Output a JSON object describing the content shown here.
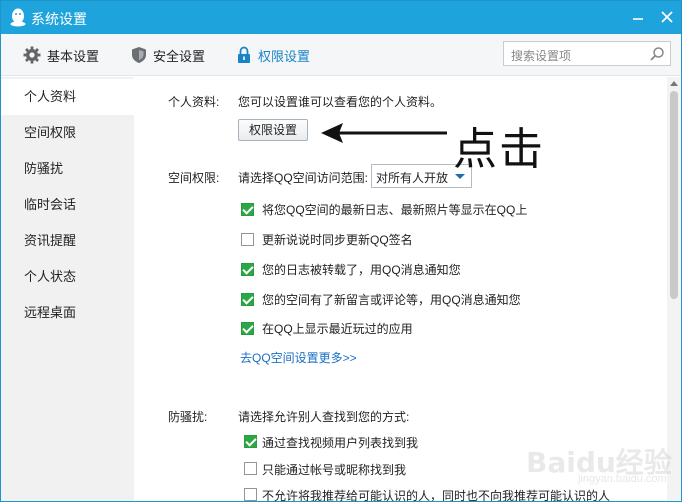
{
  "window": {
    "title": "系统设置"
  },
  "toolbar": {
    "basic_label": "基本设置",
    "security_label": "安全设置",
    "permission_label": "权限设置",
    "search_placeholder": "搜索设置项",
    "active_color": "#1a83c8"
  },
  "sidebar": {
    "items": [
      {
        "label": "个人资料",
        "active": true
      },
      {
        "label": "空间权限"
      },
      {
        "label": "防骚扰"
      },
      {
        "label": "临时会话"
      },
      {
        "label": "资讯提醒"
      },
      {
        "label": "个人状态"
      },
      {
        "label": "远程桌面"
      }
    ]
  },
  "profile": {
    "label": "个人资料:",
    "description": "您可以设置谁可以查看您的个人资料。",
    "button_label": "权限设置"
  },
  "annotation": {
    "text": "点击"
  },
  "space": {
    "label": "空间权限:",
    "range_label": "请选择QQ空间访问范围:",
    "range_value": "对所有人开放",
    "options": [
      {
        "label": "将您QQ空间的最新日志、最新照片等显示在QQ上",
        "checked": true
      },
      {
        "label": "更新说说时同步更新QQ签名",
        "checked": false
      },
      {
        "label": "您的日志被转载了，用QQ消息通知您",
        "checked": true
      },
      {
        "label": "您的空间有了新留言或评论等，用QQ消息通知您",
        "checked": true
      },
      {
        "label": "在QQ上显示最近玩过的应用",
        "checked": true
      }
    ],
    "more_link": "去QQ空间设置更多>>"
  },
  "harass": {
    "label": "防骚扰:",
    "description": "请选择允许别人查找到您的方式:",
    "options": [
      {
        "label": "通过查找视频用户列表找到我",
        "checked": true
      },
      {
        "label": "只能通过帐号或昵称找到我",
        "checked": false
      },
      {
        "label": "不允许将我推荐给可能认识的人，同时也不向我推荐可能认识的人",
        "checked": false
      }
    ]
  },
  "watermark": {
    "text": "Baidu经验",
    "sub": "jingyan.baidu.com"
  },
  "colors": {
    "titlebar": "#1fa3dd",
    "checkbox_checked": "#2ba845",
    "link": "#1a6fc4"
  }
}
